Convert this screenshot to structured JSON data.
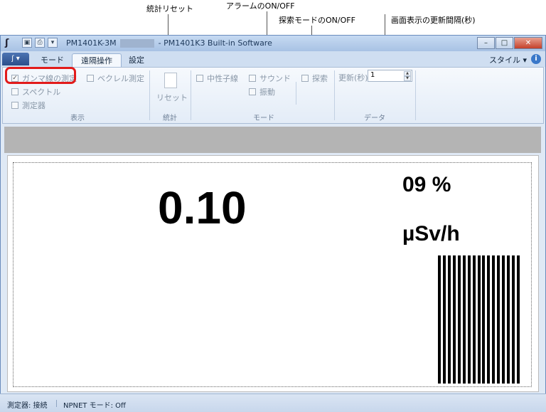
{
  "annotations": {
    "stats_reset": "統計リセット",
    "alarm_onoff": "アラームのON/OFF",
    "search_mode_onoff": "探索モードのON/OFF",
    "refresh_interval": "画面表示の更新間隔(秒)"
  },
  "titlebar": {
    "title_left": "PM1401K-3M",
    "title_right": "- PM1401K3 Built-in Software",
    "minimize": "–",
    "maximize": "□",
    "close": "✕"
  },
  "tabs": {
    "mode": "モード",
    "remote": "遠隔操作",
    "settings": "設定",
    "style_menu": "スタイル ▾",
    "help": "i"
  },
  "ribbon": {
    "gamma": "ガンマ線の測定",
    "becquerel": "ベクレル測定",
    "spectrum": "スペクトル",
    "meter": "測定器",
    "display_group": "表示",
    "reset": "リセット",
    "stats_group": "統計",
    "neutron": "中性子線",
    "sound": "サウンド",
    "vibration": "振動",
    "search": "探索",
    "mode_group": "モード",
    "update_label": "更新(秒)",
    "update_value": "1",
    "data_group": "データ"
  },
  "display": {
    "dose_rate": "0.10",
    "percent": "09 %",
    "unit": "µSv/h",
    "bar_count": 17
  },
  "status": {
    "device": "測定器: 接続",
    "npnet": "NPNET モード: Off"
  },
  "colors": {
    "highlight": "#e21b1b",
    "titlebar": "#a8c2e4",
    "graybar": "#b4b4b4"
  }
}
